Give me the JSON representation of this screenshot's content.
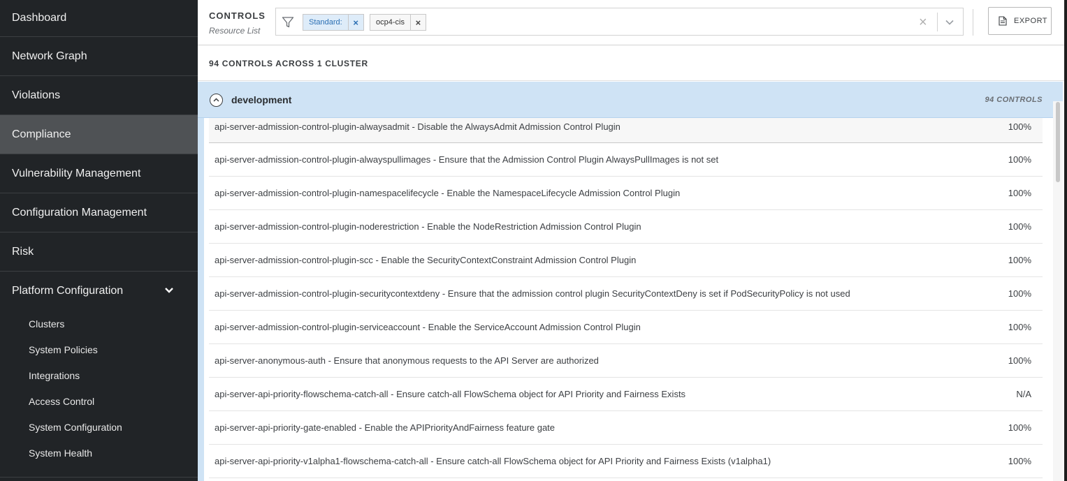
{
  "sidebar": {
    "items": [
      {
        "label": "Dashboard"
      },
      {
        "label": "Network Graph"
      },
      {
        "label": "Violations"
      },
      {
        "label": "Compliance"
      },
      {
        "label": "Vulnerability Management"
      },
      {
        "label": "Configuration Management"
      },
      {
        "label": "Risk"
      },
      {
        "label": "Platform Configuration"
      }
    ],
    "active": "Compliance",
    "subitems": [
      {
        "label": "Clusters"
      },
      {
        "label": "System Policies"
      },
      {
        "label": "Integrations"
      },
      {
        "label": "Access Control"
      },
      {
        "label": "System Configuration"
      },
      {
        "label": "System Health"
      }
    ]
  },
  "header": {
    "title": "CONTROLS",
    "subtitle": "Resource List",
    "filter_chips": [
      {
        "label": "Standard:"
      },
      {
        "label": "ocp4-cis"
      }
    ],
    "export_label": "EXPORT"
  },
  "summary": {
    "count_text": "94 CONTROLS ACROSS 1 CLUSTER"
  },
  "group": {
    "name": "development",
    "count": "94 CONTROLS",
    "rows": [
      {
        "name": "api-server-admission-control-plugin-alwaysadmit - Disable the AlwaysAdmit Admission Control Plugin",
        "value": "100%"
      },
      {
        "name": "api-server-admission-control-plugin-alwayspullimages - Ensure that the Admission Control Plugin AlwaysPullImages is not set",
        "value": "100%"
      },
      {
        "name": "api-server-admission-control-plugin-namespacelifecycle - Enable the NamespaceLifecycle Admission Control Plugin",
        "value": "100%"
      },
      {
        "name": "api-server-admission-control-plugin-noderestriction - Enable the NodeRestriction Admission Control Plugin",
        "value": "100%"
      },
      {
        "name": "api-server-admission-control-plugin-scc - Enable the SecurityContextConstraint Admission Control Plugin",
        "value": "100%"
      },
      {
        "name": "api-server-admission-control-plugin-securitycontextdeny - Ensure that the admission control plugin SecurityContextDeny is set if PodSecurityPolicy is not used",
        "value": "100%"
      },
      {
        "name": "api-server-admission-control-plugin-serviceaccount - Enable the ServiceAccount Admission Control Plugin",
        "value": "100%"
      },
      {
        "name": "api-server-anonymous-auth - Ensure that anonymous requests to the API Server are authorized",
        "value": "100%"
      },
      {
        "name": "api-server-api-priority-flowschema-catch-all - Ensure catch-all FlowSchema object for API Priority and Fairness Exists",
        "value": "N/A"
      },
      {
        "name": "api-server-api-priority-gate-enabled - Enable the APIPriorityAndFairness feature gate",
        "value": "100%"
      },
      {
        "name": "api-server-api-priority-v1alpha1-flowschema-catch-all - Ensure catch-all FlowSchema object for API Priority and Fairness Exists (v1alpha1)",
        "value": "100%"
      }
    ]
  },
  "colors": {
    "sidebar_bg": "#212427",
    "sidebar_active": "#4f5255",
    "group_header_bg": "#cfe3f5",
    "chip_standard_bg": "#deecf9"
  },
  "icons": {
    "filter": "filter-icon",
    "export": "document-icon",
    "collapse": "chevron-up-icon",
    "expand_nav": "chevron-down-icon"
  }
}
